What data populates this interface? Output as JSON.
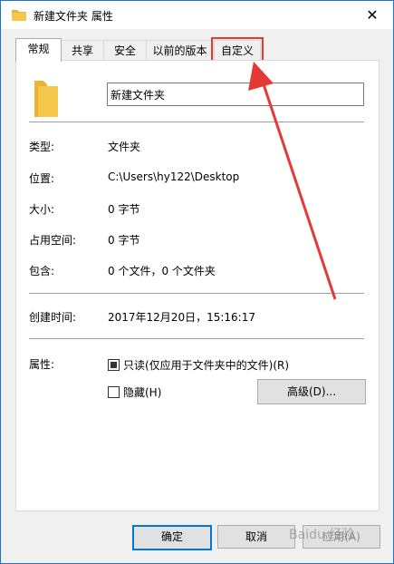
{
  "window": {
    "title": "新建文件夹 属性",
    "close_symbol": "✕"
  },
  "tabs": [
    {
      "label": "常规",
      "active": true
    },
    {
      "label": "共享",
      "active": false
    },
    {
      "label": "安全",
      "active": false
    },
    {
      "label": "以前的版本",
      "active": false
    },
    {
      "label": "自定义",
      "active": false,
      "highlighted": true
    }
  ],
  "general": {
    "folder_name": "新建文件夹",
    "rows": [
      {
        "label": "类型:",
        "value": "文件夹"
      },
      {
        "label": "位置:",
        "value": "C:\\Users\\hy122\\Desktop"
      },
      {
        "label": "大小:",
        "value": "0 字节"
      },
      {
        "label": "占用空间:",
        "value": "0 字节"
      },
      {
        "label": "包含:",
        "value": "0 个文件，0 个文件夹"
      }
    ],
    "created": {
      "label": "创建时间:",
      "value": "2017年12月20日，15:16:17"
    },
    "attributes": {
      "label": "属性:",
      "readonly_label": "只读(仅应用于文件夹中的文件)(R)",
      "hidden_label": "隐藏(H)",
      "advanced_label": "高级(D)..."
    }
  },
  "buttons": {
    "ok": "确定",
    "cancel": "取消",
    "apply": "应用(A)"
  },
  "watermark": "Baidu 经验",
  "colors": {
    "accent": "#0078d7",
    "highlight_red": "#e53935",
    "folder_yellow": "#f5c84b"
  }
}
